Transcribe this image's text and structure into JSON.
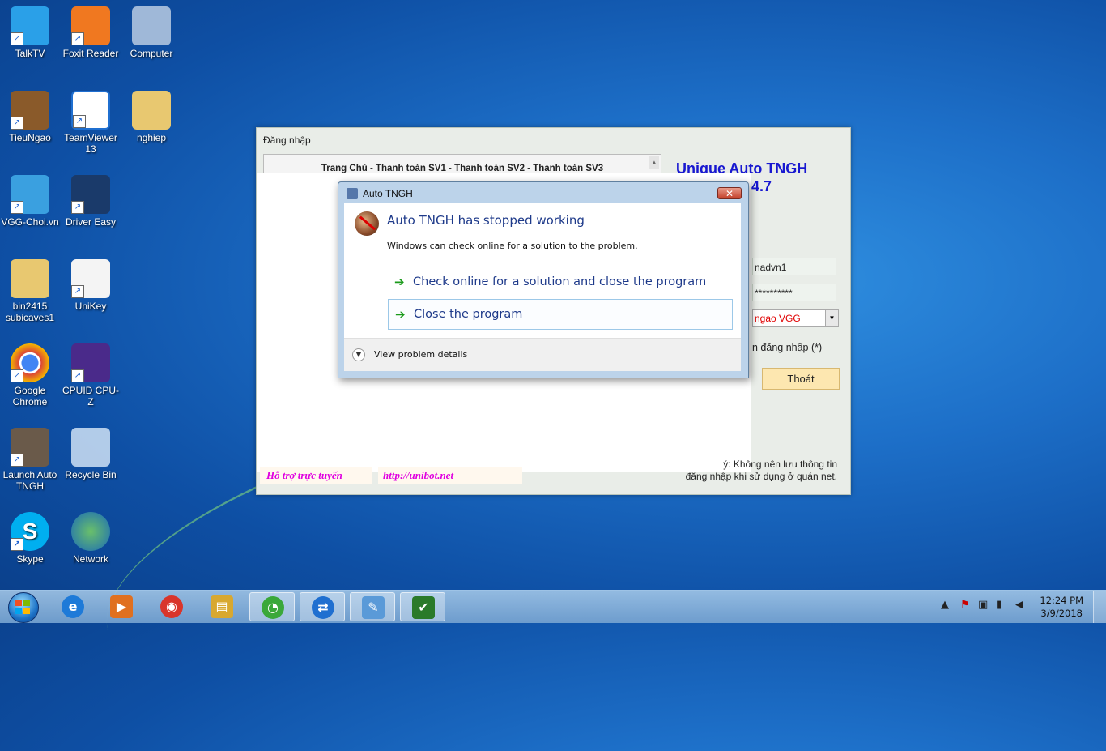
{
  "desktop": {
    "icons": [
      {
        "label": "TalkTV",
        "icon": "talktv-icon"
      },
      {
        "label": "Foxit Reader",
        "icon": "foxit-reader-icon"
      },
      {
        "label": "Computer",
        "icon": "computer-icon"
      },
      {
        "label": "TieuNgao",
        "icon": "tieungao-icon"
      },
      {
        "label": "TeamViewer 13",
        "icon": "teamviewer-icon"
      },
      {
        "label": "nghiep",
        "icon": "user-folder-icon"
      },
      {
        "label": "VGG-Choi.vn",
        "icon": "vgg-icon"
      },
      {
        "label": "Driver Easy",
        "icon": "driver-easy-icon"
      },
      {
        "label": "bin2415 subicaves1",
        "icon": "folder-icon"
      },
      {
        "label": "UniKey",
        "icon": "unikey-icon"
      },
      {
        "label": "Google Chrome",
        "icon": "chrome-icon"
      },
      {
        "label": "CPUID CPU-Z",
        "icon": "cpuz-icon"
      },
      {
        "label": "Launch Auto TNGH",
        "icon": "auto-tngh-icon"
      },
      {
        "label": "Recycle Bin",
        "icon": "recycle-bin-icon"
      },
      {
        "label": "Skype",
        "icon": "skype-icon"
      },
      {
        "label": "Network",
        "icon": "network-icon"
      }
    ]
  },
  "app_window": {
    "title": "Đăng nhập",
    "nav": "Trang Chủ - Thanh toán SV1 - Thanh toán SV2 - Thanh toán SV3",
    "heading": "Unique Auto TNGH",
    "version": ".4.7",
    "username_partial": "nadvn1",
    "password_mask": "**********",
    "server_select": "ngao VGG",
    "remember_label": "n đăng nhập (*)",
    "exit_button": "Thoát",
    "note_line1": "ý:  Không nên lưu thông tin",
    "note_line2": "đăng nhập khi sử dụng ở quán net.",
    "support_label": "Hỗ trợ trực tuyến",
    "support_link": "http://unibot.net"
  },
  "dialog": {
    "title": "Auto TNGH",
    "close_glyph": "✕",
    "heading": "Auto TNGH has stopped working",
    "subtitle": "Windows can check online for a solution to the problem.",
    "options": [
      {
        "label": "Check online for a solution and close the program",
        "selected": false
      },
      {
        "label": "Close the program",
        "selected": true
      }
    ],
    "details_label": "View problem details"
  },
  "taskbar": {
    "pinned": [
      {
        "icon": "internet-explorer-icon",
        "glyph": "e",
        "color": "#1e7ad8"
      },
      {
        "icon": "media-player-icon",
        "glyph": "▶",
        "color": "#e07020"
      },
      {
        "icon": "chrome-icon",
        "glyph": "◉",
        "color": "#d9352b"
      },
      {
        "icon": "file-explorer-icon",
        "glyph": "▤",
        "color": "#d8a830"
      },
      {
        "icon": "coc-coc-icon",
        "glyph": "◔",
        "color": "#3aa83a"
      },
      {
        "icon": "teamviewer-icon",
        "glyph": "⇄",
        "color": "#1f6fd0"
      },
      {
        "icon": "paint-icon",
        "glyph": "✎",
        "color": "#5a9ad8"
      },
      {
        "icon": "auto-tngh-icon",
        "glyph": "✔",
        "color": "#2a7a2a"
      }
    ],
    "clock_time": "12:24 PM",
    "clock_date": "3/9/2018",
    "tray_icons": [
      "show-hidden-icons-icon",
      "action-center-flag-icon",
      "device-icon",
      "network-signal-icon",
      "volume-muted-icon"
    ]
  },
  "colors": {
    "dialog_heading": "#1e3a8a",
    "app_heading": "#1818d0",
    "support_text": "#e000e0",
    "select_text": "#e00000"
  }
}
